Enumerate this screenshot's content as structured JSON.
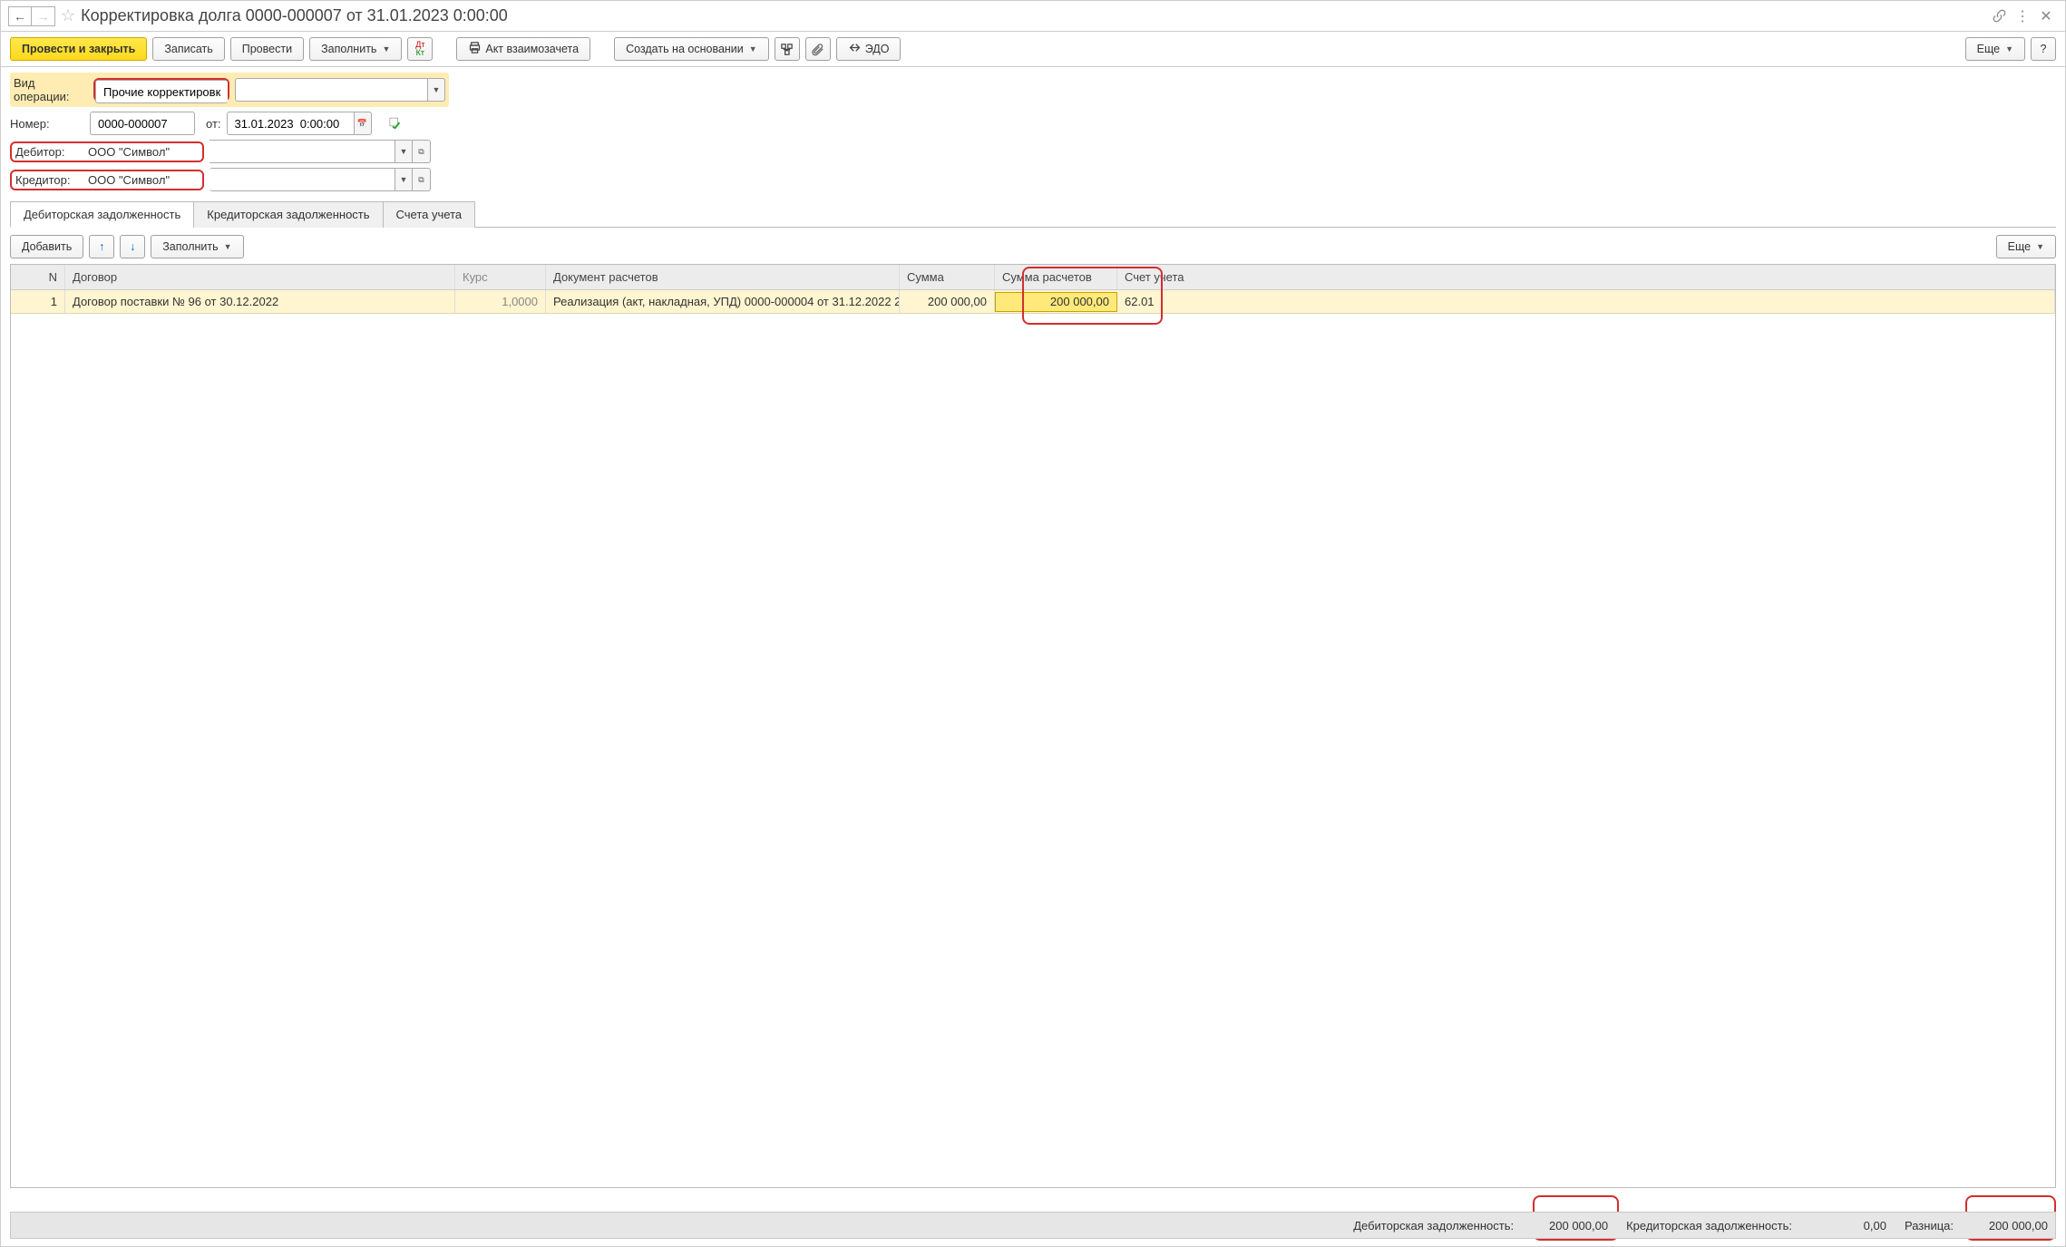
{
  "title": "Корректировка долга 0000-000007 от 31.01.2023 0:00:00",
  "toolbar": {
    "post_close": "Провести и закрыть",
    "save": "Записать",
    "post": "Провести",
    "fill": "Заполнить",
    "offset_act": "Акт взаимозачета",
    "create_based": "Создать на основании",
    "edo": "ЭДО",
    "more": "Еще",
    "help": "?"
  },
  "form": {
    "op_type_label": "Вид операции:",
    "op_type_value": "Прочие корректировки",
    "number_label": "Номер:",
    "number_value": "0000-000007",
    "date_label": "от:",
    "date_value": "31.01.2023  0:00:00",
    "debtor_label": "Дебитор:",
    "debtor_value": "ООО \"Символ\"",
    "creditor_label": "Кредитор:",
    "creditor_value": "ООО \"Символ\""
  },
  "tabs": {
    "debit": "Дебиторская задолженность",
    "credit": "Кредиторская задолженность",
    "accounts": "Счета учета"
  },
  "tabbar": {
    "add": "Добавить",
    "fill": "Заполнить",
    "more": "Еще"
  },
  "table": {
    "headers": {
      "n": "N",
      "contract": "Договор",
      "rate": "Курс",
      "doc": "Документ расчетов",
      "sum": "Сумма",
      "sum_settle": "Сумма расчетов",
      "account": "Счет учета"
    },
    "rows": [
      {
        "n": "1",
        "contract": "Договор поставки № 96 от 30.12.2022",
        "rate": "1,0000",
        "doc": "Реализация (акт, накладная, УПД) 0000-000004 от 31.12.2022 2...",
        "sum": "200 000,00",
        "sum_settle": "200 000,00",
        "account": "62.01"
      }
    ]
  },
  "footer": {
    "debit_label": "Дебиторская задолженность:",
    "debit_value": "200 000,00",
    "credit_label": "Кредиторская задолженность:",
    "credit_value": "0,00",
    "diff_label": "Разница:",
    "diff_value": "200 000,00"
  }
}
